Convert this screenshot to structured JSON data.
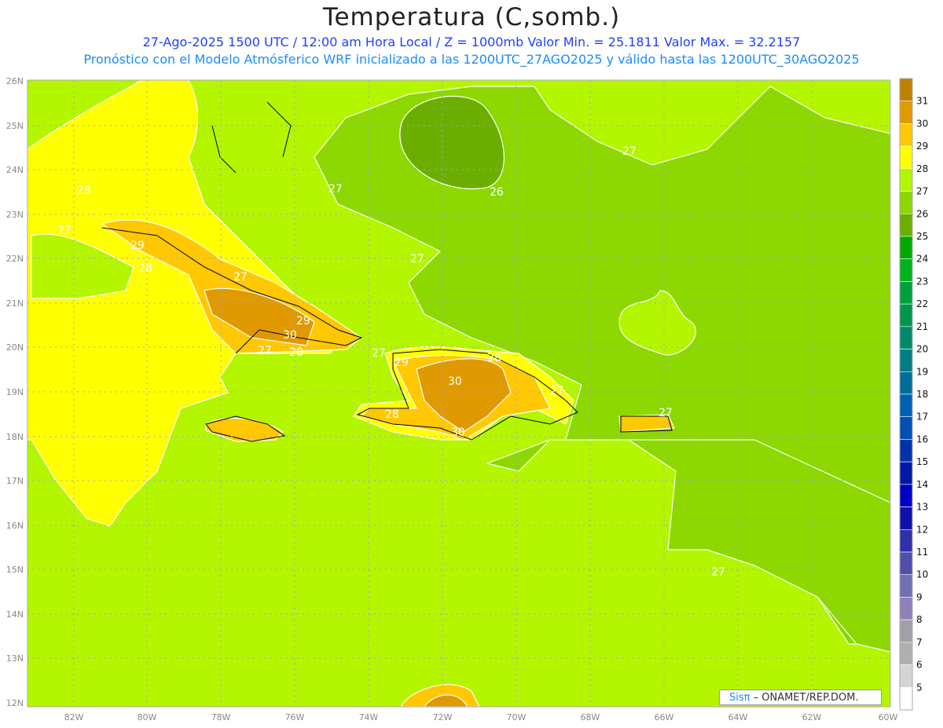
{
  "header": {
    "title": "Temperatura (C,somb.)",
    "subtitle1": "27-Ago-2025 1500 UTC / 12:00 am Hora Local / Z = 1000mb   Valor Min. = 25.1811   Valor Max. = 32.2157",
    "subtitle2": "Pronóstico con el Modelo Atmósferico WRF inicializado a las 1200UTC_27AGO2025 y válido hasta las  1200UTC_30AGO2025"
  },
  "map": {
    "lon_labels": [
      "82W",
      "80W",
      "78W",
      "76W",
      "74W",
      "72W",
      "70W",
      "68W",
      "66W",
      "64W",
      "62W",
      "60W"
    ],
    "lat_labels": [
      "26N",
      "25N",
      "24N",
      "23N",
      "22N",
      "21N",
      "20N",
      "19N",
      "18N",
      "17N",
      "16N",
      "15N",
      "14N",
      "13N",
      "12N"
    ],
    "contour_labels": [
      "27",
      "26",
      "28",
      "27",
      "29",
      "27",
      "28",
      "27",
      "27",
      "29",
      "30",
      "27",
      "28",
      "27",
      "30",
      "29",
      "28",
      "27",
      "28",
      "30",
      "27",
      "27"
    ],
    "value_range": {
      "min": 25.1811,
      "max": 32.2157
    }
  },
  "colorbar": {
    "labels": [
      "31",
      "30",
      "29",
      "28",
      "27",
      "26",
      "25",
      "24",
      "23",
      "22",
      "21",
      "20",
      "19",
      "18",
      "17",
      "16",
      "15",
      "14",
      "13",
      "12",
      "11",
      "10",
      "9",
      "8",
      "7",
      "6",
      "5"
    ],
    "colors": [
      "#c08000",
      "#e09a00",
      "#ffc800",
      "#ffff00",
      "#b4f500",
      "#8cd800",
      "#6aaf00",
      "#00aa00",
      "#00b41e",
      "#00a03c",
      "#00964f",
      "#008a6a",
      "#007d84",
      "#006e9a",
      "#0060b4",
      "#0050b4",
      "#0032aa",
      "#0018a8",
      "#0000c4",
      "#1010aa",
      "#3030aa",
      "#5050aa",
      "#7070b0",
      "#9080b8",
      "#a0a0a8",
      "#b0b0b0",
      "#d4d4d4",
      "#ffffff"
    ]
  },
  "credit": {
    "brand": "Sisπ",
    "text": "– ONAMET/REP.DOM."
  }
}
